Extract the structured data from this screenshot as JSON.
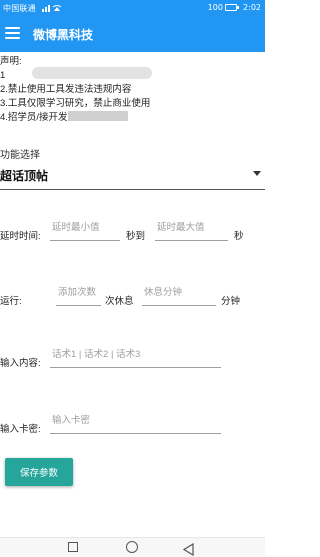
{
  "status_bar": {
    "carrier": "中国联通",
    "network_icon": "signal-wifi-icons",
    "battery_label": "100",
    "time": "2:02"
  },
  "app_bar": {
    "title": "微博黑科技",
    "menu_icon": "hamburger-menu-icon",
    "color": "#2196f3"
  },
  "notice": {
    "heading": "声明:",
    "line1": "1",
    "line2": "2.禁止使用工具发违法违规内容",
    "line3": "3.工具仅限学习研究，禁止商业使用",
    "line4": "4.招学员/接开发"
  },
  "function_select": {
    "label": "功能选择",
    "selected": "超话顶帖"
  },
  "delay": {
    "label": "延时时间:",
    "min_placeholder": "延时最小值",
    "to_label": "秒到",
    "max_placeholder": "延时最大值",
    "unit": "秒"
  },
  "run": {
    "label": "运行:",
    "count_placeholder": "添加次数",
    "rest_label": "次休息",
    "minutes_placeholder": "休息分钟",
    "unit": "分钟"
  },
  "content": {
    "label": "输入内容:",
    "placeholder": "话术1 | 话术2 | 话术3"
  },
  "card": {
    "label": "输入卡密:",
    "placeholder": "输入卡密"
  },
  "save_button": {
    "label": "保存参数",
    "color": "#26a69a"
  },
  "nav": {
    "recent_icon": "square-recents-icon",
    "home_icon": "circle-home-icon",
    "back_icon": "triangle-back-icon"
  }
}
